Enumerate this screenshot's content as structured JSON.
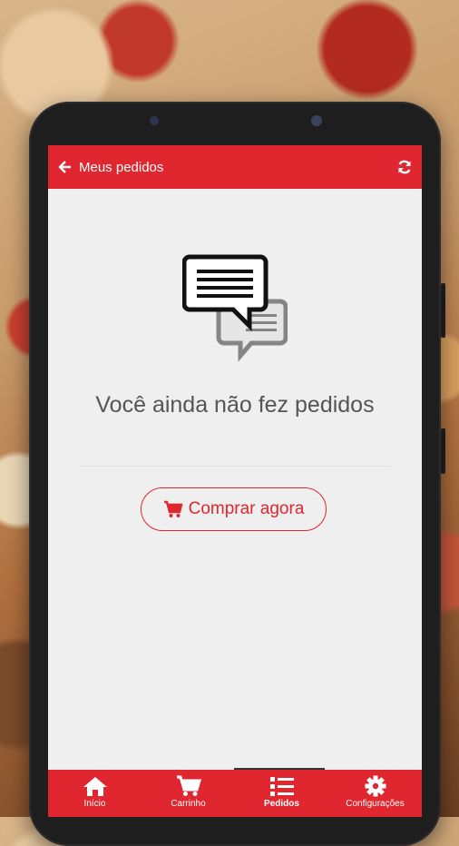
{
  "appbar": {
    "title": "Meus pedidos",
    "back_icon": "arrow-left-icon",
    "refresh_icon": "refresh-icon"
  },
  "empty_state": {
    "icon": "chat-bubbles-icon",
    "message": "Você ainda não fez pedidos"
  },
  "cta": {
    "icon": "cart-icon",
    "label": "Comprar agora"
  },
  "bottom_nav": {
    "items": [
      {
        "label": "Início",
        "icon": "home-icon"
      },
      {
        "label": "Carrinho",
        "icon": "cart-icon"
      },
      {
        "label": "Pedidos",
        "icon": "list-icon"
      },
      {
        "label": "Configurações",
        "icon": "gear-icon"
      }
    ],
    "active": "Pedidos"
  },
  "colors": {
    "primary": "#e0262f",
    "background": "#efefef",
    "text": "#555555"
  }
}
